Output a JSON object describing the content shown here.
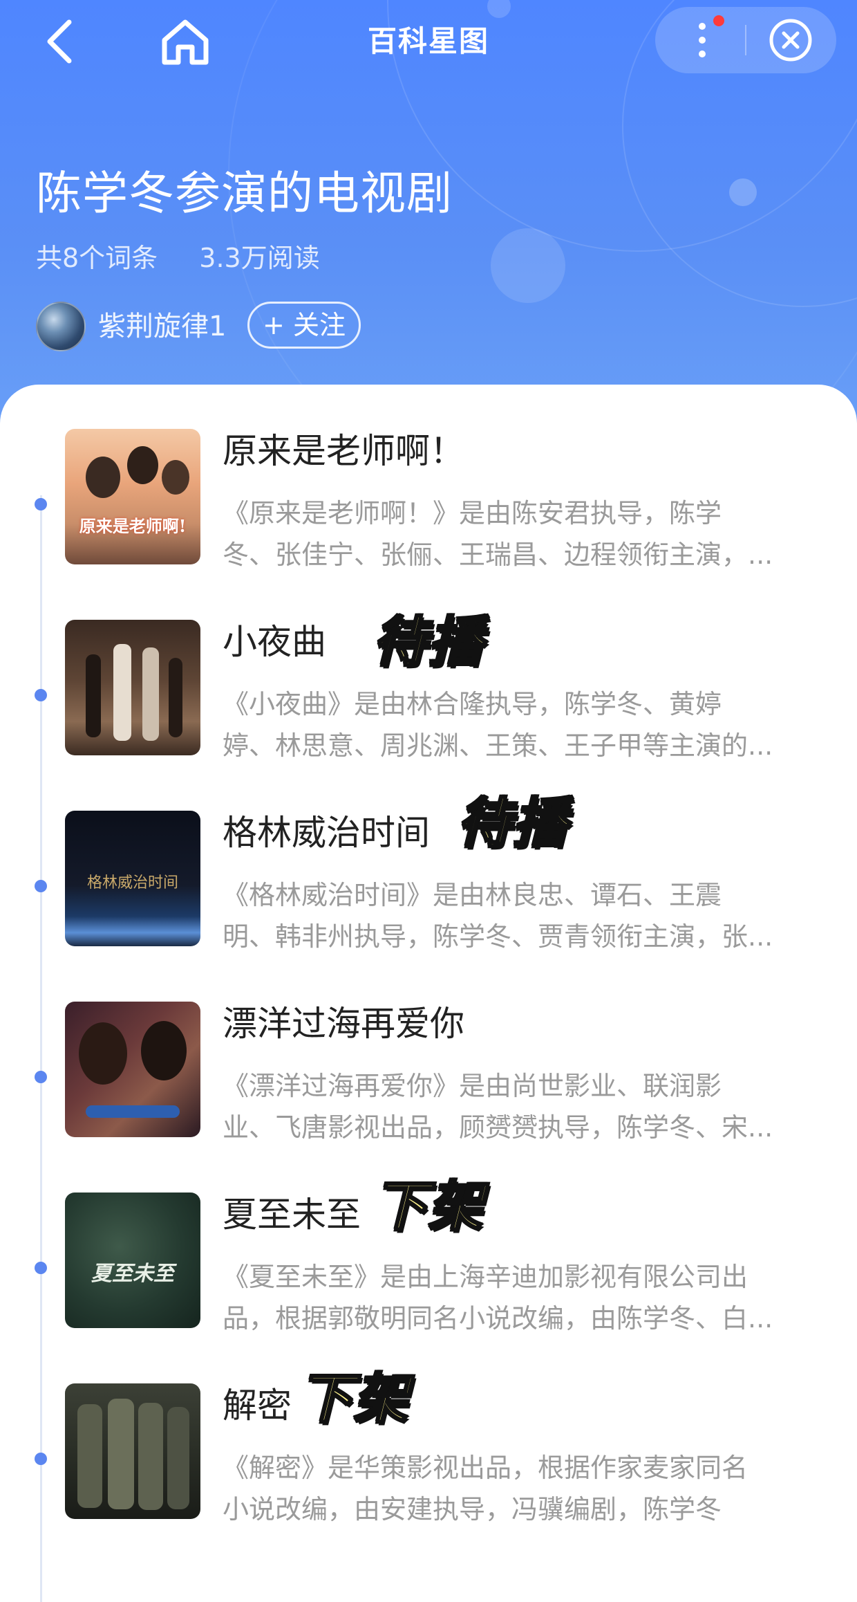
{
  "nav": {
    "title": "百科星图"
  },
  "header": {
    "title": "陈学冬参演的电视剧",
    "entry_count": "共8个词条",
    "read_count": "3.3万阅读",
    "author_name": "紫荆旋律1",
    "follow_label": "+ 关注"
  },
  "items": [
    {
      "title": "原来是老师啊！",
      "desc_line1": "《原来是老师啊！》是由陈安君执导，陈学",
      "desc_line2": "冬、张佳宁、张俪、王瑞昌、边程领衔主演，...",
      "poster_text": "原来是老师啊!"
    },
    {
      "title": "小夜曲",
      "desc_line1": "《小夜曲》是由林合隆执导，陈学冬、黄婷",
      "desc_line2": "婷、林思意、周兆渊、王策、王子甲等主演的...",
      "sticker": "待播"
    },
    {
      "title": "格林威治时间",
      "desc_line1": "《格林威治时间》是由林良忠、谭石、王震",
      "desc_line2": "明、韩非州执导，陈学冬、贾青领衔主演，张...",
      "sticker": "待播",
      "poster_text": "格林威治时间"
    },
    {
      "title": "漂洋过海再爱你",
      "desc_line1": "《漂洋过海再爱你》是由尚世影业、联润影",
      "desc_line2": "业、飞唐影视出品，顾赟赟执导，陈学冬、宋..."
    },
    {
      "title": "夏至未至",
      "desc_line1": "《夏至未至》是由上海辛迪加影视有限公司出",
      "desc_line2": "品，根据郭敬明同名小说改编，由陈学冬、白...",
      "sticker": "下架",
      "poster_text": "夏至未至"
    },
    {
      "title": "解密",
      "desc_line1": "《解密》是华策影视出品，根据作家麦家同名",
      "desc_line2": "小说改编，由安建执导，冯骥编剧，陈学冬",
      "sticker": "下架"
    }
  ],
  "colors": {
    "header_blue": "#4f86ff",
    "timeline_dot": "#5b86f0",
    "sticker_yellow": "#fdf28c"
  }
}
